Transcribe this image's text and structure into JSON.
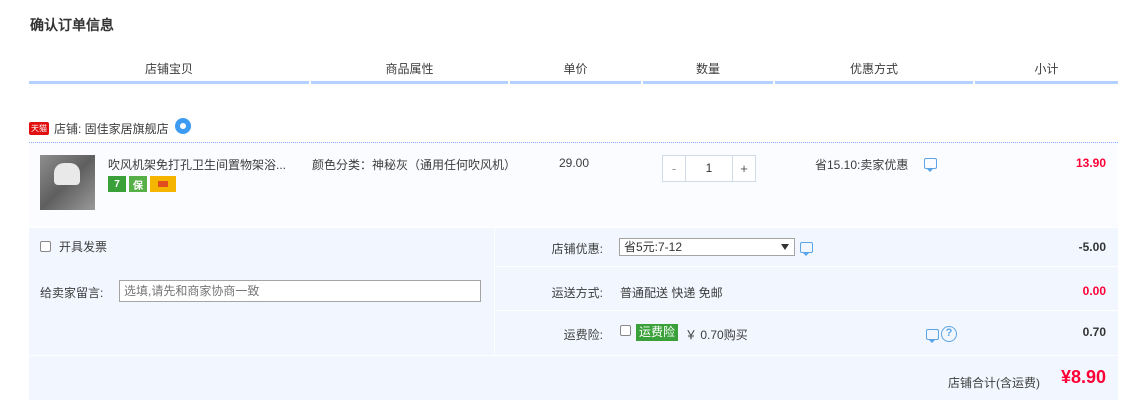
{
  "page_title": "确认订单信息",
  "columns": [
    "店铺宝贝",
    "商品属性",
    "单价",
    "数量",
    "优惠方式",
    "小计"
  ],
  "shop": {
    "badge": "天猫",
    "label": "店铺: 固佳家居旗舰店",
    "contact_icon": "wangwang-icon"
  },
  "item": {
    "title": "吹风机架免打孔卫生间置物架浴...",
    "service_icons": [
      "7",
      "保",
      "card"
    ],
    "attribute": "颜色分类：神秘灰（通用任何吹风机）",
    "unit_price": "29.00",
    "quantity": {
      "minus": "-",
      "value": "1",
      "plus": "+"
    },
    "discount": "省15.10:卖家优惠",
    "subtotal": "13.90"
  },
  "order": {
    "invoice_label": "开具发票",
    "memo_label": "给卖家留言:",
    "memo_placeholder": "选填,请先和商家协商一致",
    "shop_discount_label": "店铺优惠:",
    "shop_discount_selected": "省5元:7-12",
    "shop_discount_value": "-5.00",
    "shipping_label": "运送方式:",
    "shipping_method": "普通配送 快递 免邮",
    "shipping_value": "0.00",
    "insurance_label": "运费险:",
    "insurance_badge": "运费险",
    "insurance_price": "￥ 0.70购买",
    "insurance_help": "?",
    "insurance_value": "0.70",
    "total_label": "店铺合计(含运费)",
    "total_value": "¥8.90"
  },
  "colors": {
    "price_red": "#ff0036",
    "header_line": "#b2d1ff",
    "panel_bg": "#f2f7ff",
    "tmall_red": "#e10f0f",
    "green_badge": "#3aa03a"
  }
}
